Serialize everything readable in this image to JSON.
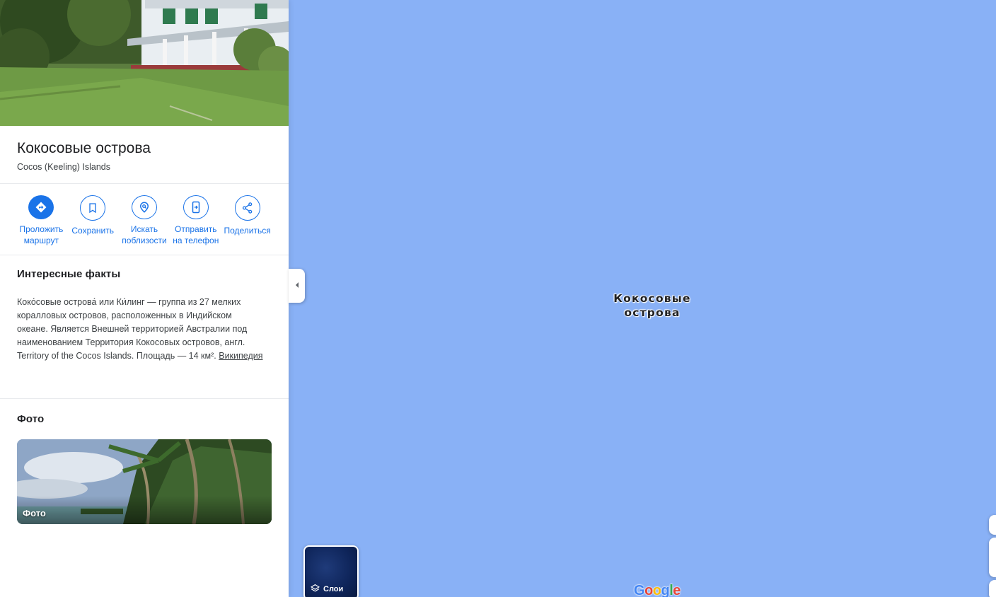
{
  "place": {
    "title": "Кокосовые острова",
    "subtitle": "Cocos (Keeling) Islands"
  },
  "actions": [
    {
      "label": "Проложить\nмаршрут",
      "icon": "directions-icon"
    },
    {
      "label": "Сохранить",
      "icon": "bookmark-icon"
    },
    {
      "label": "Искать\nпоблизости",
      "icon": "nearby-search-icon"
    },
    {
      "label": "Отправить\nна телефон",
      "icon": "send-to-phone-icon"
    },
    {
      "label": "Поделиться",
      "icon": "share-icon"
    }
  ],
  "facts": {
    "heading": "Интересные факты",
    "text": "Коко́совые острова́ или Ки́линг — группа из 27 мелких коралловых островов, расположенных в Индийском океане. Является Внешней территорией Австралии под наименованием Территория Кокосовых островов, англ. Territory of the Cocos Islands. Площадь — 14 км². ",
    "link": "Википедия"
  },
  "photos": {
    "heading": "Фото",
    "card_label": "Фото"
  },
  "map": {
    "label_line1": "Кокосовые",
    "label_line2": "острова",
    "layers_label": "Слои",
    "logo": "Google"
  },
  "colors": {
    "accent": "#1a73e8",
    "water": "#89b1f6"
  }
}
